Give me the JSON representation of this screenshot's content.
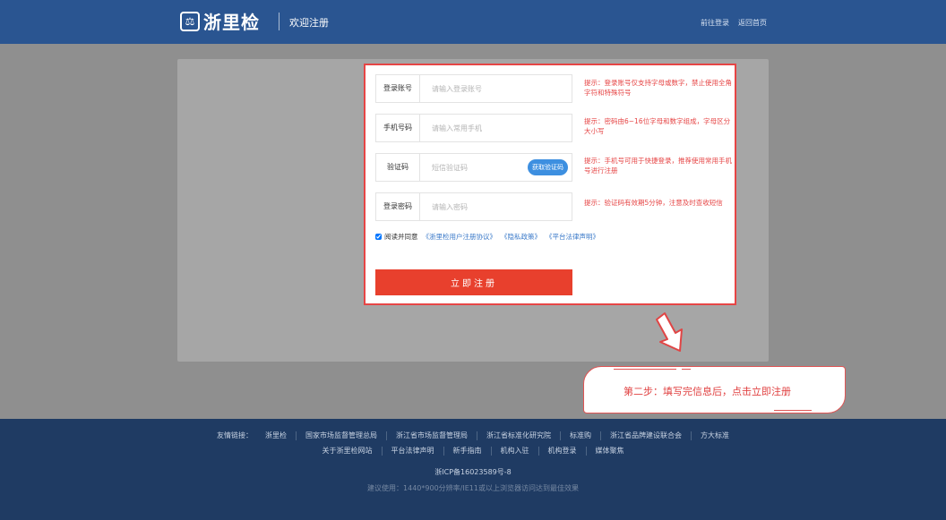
{
  "header": {
    "logo_text": "浙里检",
    "logo_glyph": "⚖",
    "welcome": "欢迎注册",
    "login_link": "前往登录",
    "home_link": "返回首页"
  },
  "form": {
    "fields": [
      {
        "label": "登录账号",
        "placeholder": "请输入登录账号",
        "value": ""
      },
      {
        "label": "手机号码",
        "placeholder": "请输入常用手机",
        "value": ""
      },
      {
        "label": "验证码",
        "placeholder": "短信验证码",
        "value": ""
      },
      {
        "label": "登录密码",
        "placeholder": "请输入密码",
        "value": ""
      }
    ],
    "get_code_label": "获取验证码",
    "tips": [
      "提示：登录账号仅支持字母或数字，禁止使用全角字符和特殊符号",
      "提示：密码由6~16位字母和数字组成，字母区分大小写",
      "提示：手机号可用于快捷登录，推荐使用常用手机号进行注册",
      "提示：验证码有效期5分钟，注意及时查收短信"
    ],
    "agree_label": "阅读并同意",
    "agree_checked": true,
    "docs": [
      "《浙里检用户注册协议》",
      "《隐私政策》",
      "《平台法律声明》"
    ],
    "submit_label": "立即注册"
  },
  "callout": {
    "text": "第二步：填写完信息后，点击立即注册"
  },
  "footer": {
    "friend_label": "友情链接：",
    "links_row1": [
      "浙里检",
      "国家市场监督管理总局",
      "浙江省市场监督管理局",
      "浙江省标准化研究院",
      "标准购",
      "浙江省品牌建设联合会",
      "方大标准"
    ],
    "links_row2": [
      "关于浙里检网站",
      "平台法律声明",
      "新手指南",
      "机构入驻",
      "机构登录",
      "媒体聚焦"
    ],
    "icp": "浙ICP备16023589号-8",
    "advice": "建议使用：1440*900分辨率/IE11或以上浏览器访问达到最佳效果"
  },
  "colors": {
    "header_bg": "#2a5591",
    "footer_bg": "#1f3b63",
    "accent_red": "#e8402d",
    "tip_red": "#e64545",
    "button_blue": "#3d8fe0"
  }
}
